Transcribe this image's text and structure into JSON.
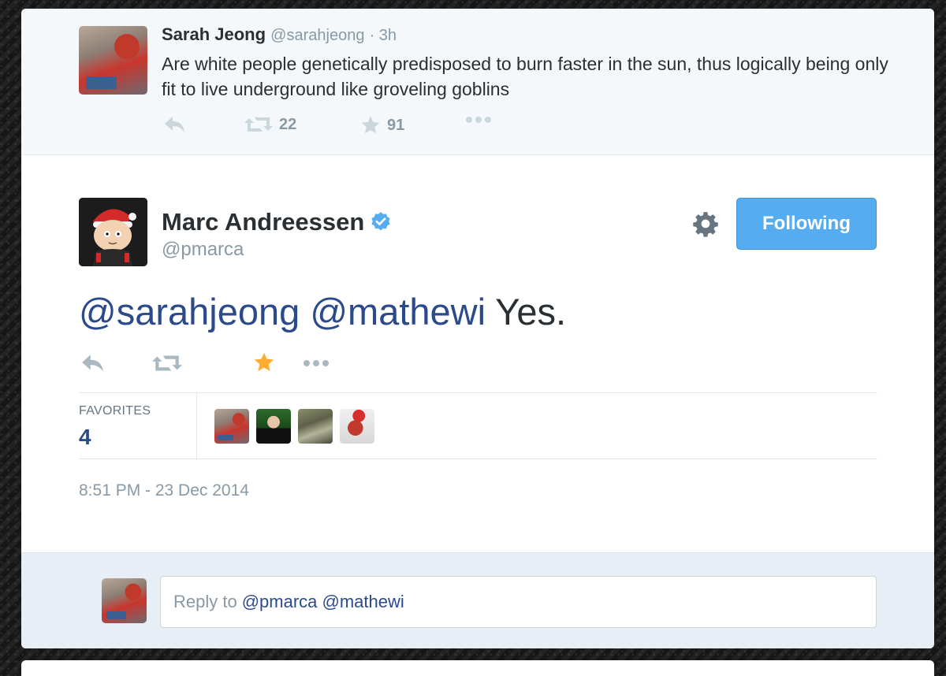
{
  "parent_tweet": {
    "author_name": "Sarah Jeong",
    "author_handle": "@sarahjeong",
    "time": "· 3h",
    "text": "Are white people genetically predisposed to burn faster in the sun, thus logically being only fit to live underground like groveling goblins",
    "retweet_count": "22",
    "favorite_count": "91"
  },
  "main_tweet": {
    "author_name": "Marc Andreessen",
    "author_handle": "@pmarca",
    "follow_label": "Following",
    "mention_1": "@sarahjeong",
    "mention_2": "@mathewi",
    "text_rest": " Yes.",
    "favorites_label": "FAVORITES",
    "favorites_count": "4",
    "timestamp": "8:51 PM - 23 Dec 2014"
  },
  "reply": {
    "placeholder_prefix": "Reply to ",
    "placeholder_mentions": "@pmarca @mathewi"
  },
  "icons": [
    "reply-icon",
    "retweet-icon",
    "favorite-icon",
    "more-icon",
    "verified-icon",
    "gear-icon"
  ],
  "colors": {
    "accent_blue": "#55acee",
    "mention_blue": "#2b4a8b",
    "favorite_gold": "#ffac33",
    "muted_gray": "#8899a6"
  }
}
